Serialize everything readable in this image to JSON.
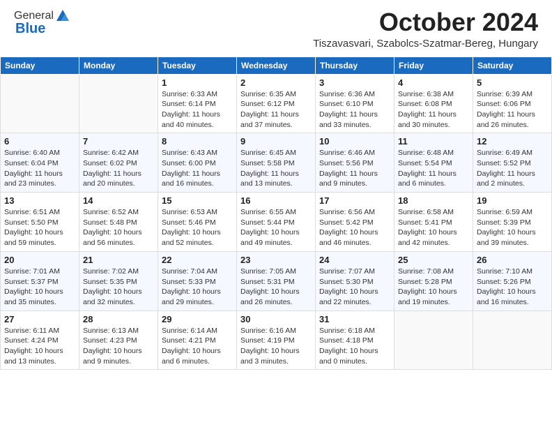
{
  "header": {
    "logo_general": "General",
    "logo_blue": "Blue",
    "month_title": "October 2024",
    "location": "Tiszavasvari, Szabolcs-Szatmar-Bereg, Hungary"
  },
  "weekdays": [
    "Sunday",
    "Monday",
    "Tuesday",
    "Wednesday",
    "Thursday",
    "Friday",
    "Saturday"
  ],
  "weeks": [
    [
      {
        "day": "",
        "info": ""
      },
      {
        "day": "",
        "info": ""
      },
      {
        "day": "1",
        "info": "Sunrise: 6:33 AM\nSunset: 6:14 PM\nDaylight: 11 hours and 40 minutes."
      },
      {
        "day": "2",
        "info": "Sunrise: 6:35 AM\nSunset: 6:12 PM\nDaylight: 11 hours and 37 minutes."
      },
      {
        "day": "3",
        "info": "Sunrise: 6:36 AM\nSunset: 6:10 PM\nDaylight: 11 hours and 33 minutes."
      },
      {
        "day": "4",
        "info": "Sunrise: 6:38 AM\nSunset: 6:08 PM\nDaylight: 11 hours and 30 minutes."
      },
      {
        "day": "5",
        "info": "Sunrise: 6:39 AM\nSunset: 6:06 PM\nDaylight: 11 hours and 26 minutes."
      }
    ],
    [
      {
        "day": "6",
        "info": "Sunrise: 6:40 AM\nSunset: 6:04 PM\nDaylight: 11 hours and 23 minutes."
      },
      {
        "day": "7",
        "info": "Sunrise: 6:42 AM\nSunset: 6:02 PM\nDaylight: 11 hours and 20 minutes."
      },
      {
        "day": "8",
        "info": "Sunrise: 6:43 AM\nSunset: 6:00 PM\nDaylight: 11 hours and 16 minutes."
      },
      {
        "day": "9",
        "info": "Sunrise: 6:45 AM\nSunset: 5:58 PM\nDaylight: 11 hours and 13 minutes."
      },
      {
        "day": "10",
        "info": "Sunrise: 6:46 AM\nSunset: 5:56 PM\nDaylight: 11 hours and 9 minutes."
      },
      {
        "day": "11",
        "info": "Sunrise: 6:48 AM\nSunset: 5:54 PM\nDaylight: 11 hours and 6 minutes."
      },
      {
        "day": "12",
        "info": "Sunrise: 6:49 AM\nSunset: 5:52 PM\nDaylight: 11 hours and 2 minutes."
      }
    ],
    [
      {
        "day": "13",
        "info": "Sunrise: 6:51 AM\nSunset: 5:50 PM\nDaylight: 10 hours and 59 minutes."
      },
      {
        "day": "14",
        "info": "Sunrise: 6:52 AM\nSunset: 5:48 PM\nDaylight: 10 hours and 56 minutes."
      },
      {
        "day": "15",
        "info": "Sunrise: 6:53 AM\nSunset: 5:46 PM\nDaylight: 10 hours and 52 minutes."
      },
      {
        "day": "16",
        "info": "Sunrise: 6:55 AM\nSunset: 5:44 PM\nDaylight: 10 hours and 49 minutes."
      },
      {
        "day": "17",
        "info": "Sunrise: 6:56 AM\nSunset: 5:42 PM\nDaylight: 10 hours and 46 minutes."
      },
      {
        "day": "18",
        "info": "Sunrise: 6:58 AM\nSunset: 5:41 PM\nDaylight: 10 hours and 42 minutes."
      },
      {
        "day": "19",
        "info": "Sunrise: 6:59 AM\nSunset: 5:39 PM\nDaylight: 10 hours and 39 minutes."
      }
    ],
    [
      {
        "day": "20",
        "info": "Sunrise: 7:01 AM\nSunset: 5:37 PM\nDaylight: 10 hours and 35 minutes."
      },
      {
        "day": "21",
        "info": "Sunrise: 7:02 AM\nSunset: 5:35 PM\nDaylight: 10 hours and 32 minutes."
      },
      {
        "day": "22",
        "info": "Sunrise: 7:04 AM\nSunset: 5:33 PM\nDaylight: 10 hours and 29 minutes."
      },
      {
        "day": "23",
        "info": "Sunrise: 7:05 AM\nSunset: 5:31 PM\nDaylight: 10 hours and 26 minutes."
      },
      {
        "day": "24",
        "info": "Sunrise: 7:07 AM\nSunset: 5:30 PM\nDaylight: 10 hours and 22 minutes."
      },
      {
        "day": "25",
        "info": "Sunrise: 7:08 AM\nSunset: 5:28 PM\nDaylight: 10 hours and 19 minutes."
      },
      {
        "day": "26",
        "info": "Sunrise: 7:10 AM\nSunset: 5:26 PM\nDaylight: 10 hours and 16 minutes."
      }
    ],
    [
      {
        "day": "27",
        "info": "Sunrise: 6:11 AM\nSunset: 4:24 PM\nDaylight: 10 hours and 13 minutes."
      },
      {
        "day": "28",
        "info": "Sunrise: 6:13 AM\nSunset: 4:23 PM\nDaylight: 10 hours and 9 minutes."
      },
      {
        "day": "29",
        "info": "Sunrise: 6:14 AM\nSunset: 4:21 PM\nDaylight: 10 hours and 6 minutes."
      },
      {
        "day": "30",
        "info": "Sunrise: 6:16 AM\nSunset: 4:19 PM\nDaylight: 10 hours and 3 minutes."
      },
      {
        "day": "31",
        "info": "Sunrise: 6:18 AM\nSunset: 4:18 PM\nDaylight: 10 hours and 0 minutes."
      },
      {
        "day": "",
        "info": ""
      },
      {
        "day": "",
        "info": ""
      }
    ]
  ]
}
